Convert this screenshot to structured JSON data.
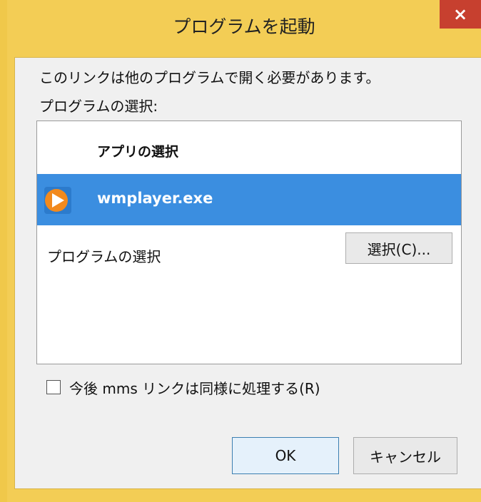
{
  "window": {
    "title": "プログラムを起動",
    "close_label": "×"
  },
  "dialog": {
    "message": "このリンクは他のプログラムで開く必要があります。",
    "program_select_label": "プログラムの選択:",
    "list": {
      "header": "アプリの選択",
      "selected_item": {
        "name": "wmplayer.exe",
        "icon": "media-player-icon"
      },
      "choose_program_label": "プログラムの選択",
      "choose_button_label": "選択(C)..."
    },
    "remember_checkbox": {
      "checked": false,
      "label": "今後 mms リンクは同様に処理する(R)"
    },
    "ok_label": "OK",
    "cancel_label": "キャンセル"
  },
  "colors": {
    "accent": "#3b8ee0",
    "close": "#c7402f",
    "background": "#f0c84a"
  }
}
